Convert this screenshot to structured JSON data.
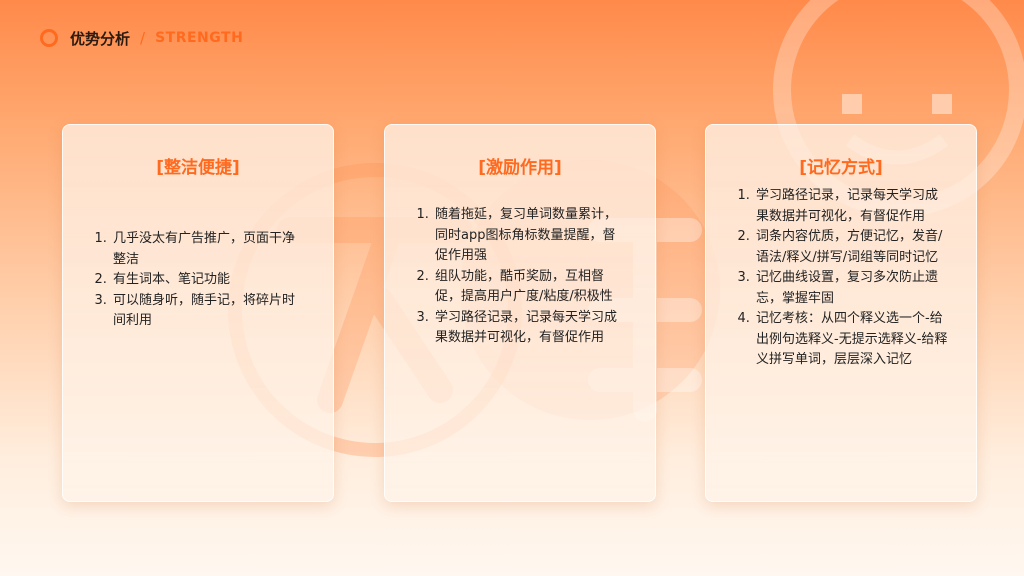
{
  "header": {
    "title": "优势分析",
    "separator": "/",
    "subtitle": "STRENGTH"
  },
  "colors": {
    "accent": "#ff6a1f",
    "text": "#222222",
    "background_top": "#ff8a4a",
    "background_bottom": "#fff7f0"
  },
  "cards": [
    {
      "heading": "[整洁便捷]",
      "items": [
        "几乎没太有广告推广，页面干净整洁",
        "有生词本、笔记功能",
        "可以随身听，随手记，将碎片时间利用"
      ]
    },
    {
      "heading": "[激励作用]",
      "items": [
        "随着拖延，复习单词数量累计，同时app图标角标数量提醒，督促作用强",
        "组队功能，酷币奖励，互相督促，提高用户广度/粘度/积极性",
        "学习路径记录，记录每天学习成果数据并可视化，有督促作用"
      ]
    },
    {
      "heading": "[记忆方式]",
      "items": [
        "学习路径记录，记录每天学习成果数据并可视化，有督促作用",
        "词条内容优质，方便记忆，发音/语法/释义/拼写/词组等同时记忆",
        "记忆曲线设置，复习多次防止遗忘，掌握牢固",
        "记忆考核：从四个释义选一个-给出例句选释义-无提示选释义-给释义拼写单词，层层深入记忆"
      ]
    }
  ]
}
